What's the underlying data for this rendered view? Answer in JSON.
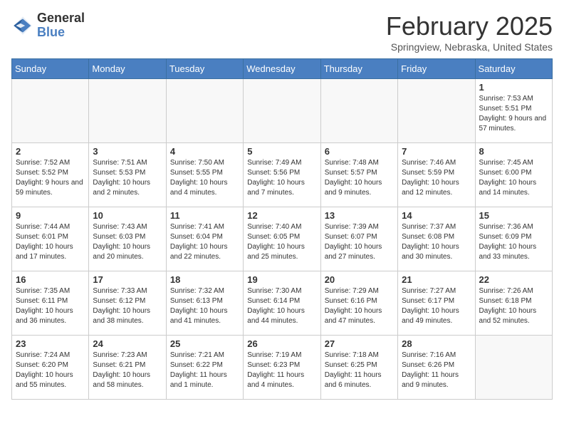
{
  "header": {
    "logo_line1": "General",
    "logo_line2": "Blue",
    "title": "February 2025",
    "subtitle": "Springview, Nebraska, United States"
  },
  "weekdays": [
    "Sunday",
    "Monday",
    "Tuesday",
    "Wednesday",
    "Thursday",
    "Friday",
    "Saturday"
  ],
  "weeks": [
    [
      {
        "day": "",
        "info": ""
      },
      {
        "day": "",
        "info": ""
      },
      {
        "day": "",
        "info": ""
      },
      {
        "day": "",
        "info": ""
      },
      {
        "day": "",
        "info": ""
      },
      {
        "day": "",
        "info": ""
      },
      {
        "day": "1",
        "info": "Sunrise: 7:53 AM\nSunset: 5:51 PM\nDaylight: 9 hours and 57 minutes."
      }
    ],
    [
      {
        "day": "2",
        "info": "Sunrise: 7:52 AM\nSunset: 5:52 PM\nDaylight: 9 hours and 59 minutes."
      },
      {
        "day": "3",
        "info": "Sunrise: 7:51 AM\nSunset: 5:53 PM\nDaylight: 10 hours and 2 minutes."
      },
      {
        "day": "4",
        "info": "Sunrise: 7:50 AM\nSunset: 5:55 PM\nDaylight: 10 hours and 4 minutes."
      },
      {
        "day": "5",
        "info": "Sunrise: 7:49 AM\nSunset: 5:56 PM\nDaylight: 10 hours and 7 minutes."
      },
      {
        "day": "6",
        "info": "Sunrise: 7:48 AM\nSunset: 5:57 PM\nDaylight: 10 hours and 9 minutes."
      },
      {
        "day": "7",
        "info": "Sunrise: 7:46 AM\nSunset: 5:59 PM\nDaylight: 10 hours and 12 minutes."
      },
      {
        "day": "8",
        "info": "Sunrise: 7:45 AM\nSunset: 6:00 PM\nDaylight: 10 hours and 14 minutes."
      }
    ],
    [
      {
        "day": "9",
        "info": "Sunrise: 7:44 AM\nSunset: 6:01 PM\nDaylight: 10 hours and 17 minutes."
      },
      {
        "day": "10",
        "info": "Sunrise: 7:43 AM\nSunset: 6:03 PM\nDaylight: 10 hours and 20 minutes."
      },
      {
        "day": "11",
        "info": "Sunrise: 7:41 AM\nSunset: 6:04 PM\nDaylight: 10 hours and 22 minutes."
      },
      {
        "day": "12",
        "info": "Sunrise: 7:40 AM\nSunset: 6:05 PM\nDaylight: 10 hours and 25 minutes."
      },
      {
        "day": "13",
        "info": "Sunrise: 7:39 AM\nSunset: 6:07 PM\nDaylight: 10 hours and 27 minutes."
      },
      {
        "day": "14",
        "info": "Sunrise: 7:37 AM\nSunset: 6:08 PM\nDaylight: 10 hours and 30 minutes."
      },
      {
        "day": "15",
        "info": "Sunrise: 7:36 AM\nSunset: 6:09 PM\nDaylight: 10 hours and 33 minutes."
      }
    ],
    [
      {
        "day": "16",
        "info": "Sunrise: 7:35 AM\nSunset: 6:11 PM\nDaylight: 10 hours and 36 minutes."
      },
      {
        "day": "17",
        "info": "Sunrise: 7:33 AM\nSunset: 6:12 PM\nDaylight: 10 hours and 38 minutes."
      },
      {
        "day": "18",
        "info": "Sunrise: 7:32 AM\nSunset: 6:13 PM\nDaylight: 10 hours and 41 minutes."
      },
      {
        "day": "19",
        "info": "Sunrise: 7:30 AM\nSunset: 6:14 PM\nDaylight: 10 hours and 44 minutes."
      },
      {
        "day": "20",
        "info": "Sunrise: 7:29 AM\nSunset: 6:16 PM\nDaylight: 10 hours and 47 minutes."
      },
      {
        "day": "21",
        "info": "Sunrise: 7:27 AM\nSunset: 6:17 PM\nDaylight: 10 hours and 49 minutes."
      },
      {
        "day": "22",
        "info": "Sunrise: 7:26 AM\nSunset: 6:18 PM\nDaylight: 10 hours and 52 minutes."
      }
    ],
    [
      {
        "day": "23",
        "info": "Sunrise: 7:24 AM\nSunset: 6:20 PM\nDaylight: 10 hours and 55 minutes."
      },
      {
        "day": "24",
        "info": "Sunrise: 7:23 AM\nSunset: 6:21 PM\nDaylight: 10 hours and 58 minutes."
      },
      {
        "day": "25",
        "info": "Sunrise: 7:21 AM\nSunset: 6:22 PM\nDaylight: 11 hours and 1 minute."
      },
      {
        "day": "26",
        "info": "Sunrise: 7:19 AM\nSunset: 6:23 PM\nDaylight: 11 hours and 4 minutes."
      },
      {
        "day": "27",
        "info": "Sunrise: 7:18 AM\nSunset: 6:25 PM\nDaylight: 11 hours and 6 minutes."
      },
      {
        "day": "28",
        "info": "Sunrise: 7:16 AM\nSunset: 6:26 PM\nDaylight: 11 hours and 9 minutes."
      },
      {
        "day": "",
        "info": ""
      }
    ]
  ]
}
